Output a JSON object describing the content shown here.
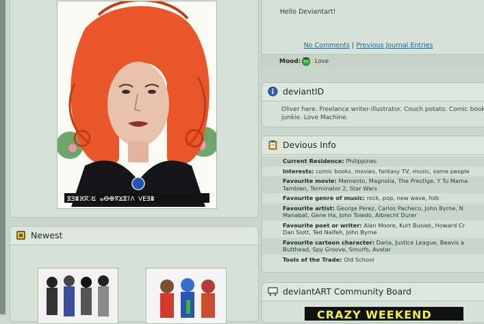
{
  "journal": {
    "body": "Hello Deviantart!",
    "comments_link": "No Comments",
    "separator": "|",
    "previous_link": "Previous Journal Entries",
    "mood_label": "Mood:",
    "mood_value": "Love"
  },
  "deviantid": {
    "title": "deviantID",
    "text": "Oliver here. Freelance writer-illustrator. Couch potato. Comic book junkie. Love Machine."
  },
  "devious_info": {
    "title": "Devious Info",
    "rows": [
      {
        "label": "Current Residence:",
        "value": "Philippines"
      },
      {
        "label": "Interests:",
        "value": "comic books, movies, fantasy TV, music, some people"
      },
      {
        "label": "Favourite movie:",
        "value": "Memento, Magnolia, The Prestige, Y Tu Mama",
        "value2": "Tambien, Terminator 2, Star Wars"
      },
      {
        "label": "Favourite genre of music:",
        "value": "rock, pop, new wave, folk"
      },
      {
        "label": "Favourite artist:",
        "value": "George Perez, Carlos Pacheco, John Byrne, N",
        "value2": "Manabat, Gene Ha, John Toledo, Albrecht Durer"
      },
      {
        "label": "Favourite poet or writer:",
        "value": "Alan Moore, Kurt Busiek, Howard Cr",
        "value2": "Dan Slott, Ted Naifeh, John Byrne"
      },
      {
        "label": "Favourite cartoon character:",
        "value": "Daria, Justice League, Beavis a",
        "value2": "Butthead, Spy Groove, Smurfs, Avatar"
      },
      {
        "label": "Tools of the Trade:",
        "value": "Old School"
      }
    ]
  },
  "newest": {
    "title": "Newest"
  },
  "board": {
    "title": "deviantART Community Board",
    "banner": "CRAZY WEEKEND"
  },
  "colors": {
    "page_bg": "#cad7cc",
    "panel_bg": "#d6e2d8",
    "link": "#2a5f8f",
    "hair": "#e8562a"
  }
}
